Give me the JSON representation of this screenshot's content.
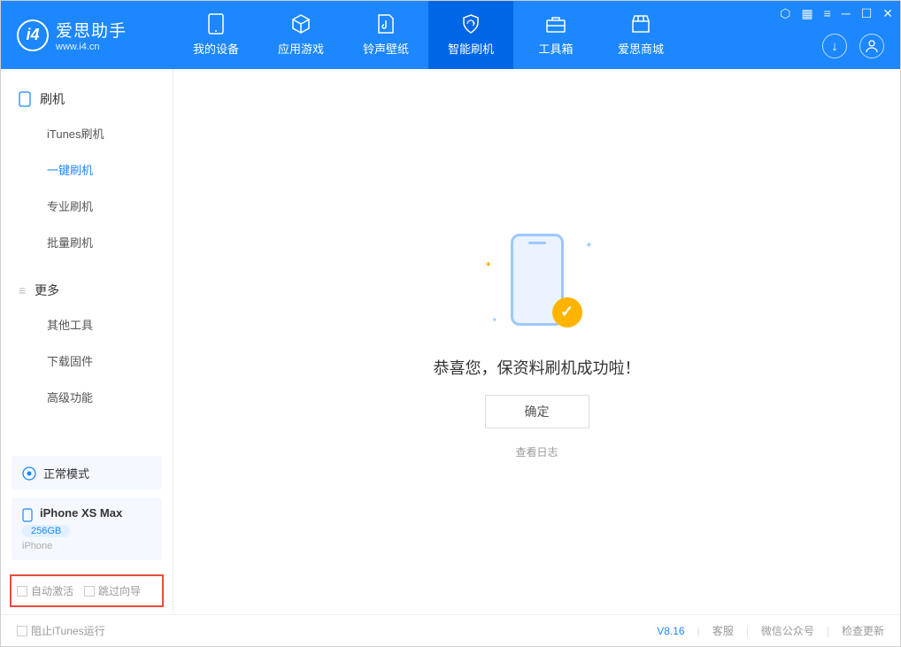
{
  "app": {
    "title": "爱思助手",
    "subtitle": "www.i4.cn"
  },
  "nav": {
    "tabs": [
      {
        "label": "我的设备"
      },
      {
        "label": "应用游戏"
      },
      {
        "label": "铃声壁纸"
      },
      {
        "label": "智能刷机"
      },
      {
        "label": "工具箱"
      },
      {
        "label": "爱思商城"
      }
    ]
  },
  "sidebar": {
    "group1": {
      "title": "刷机",
      "items": [
        {
          "label": "iTunes刷机"
        },
        {
          "label": "一键刷机"
        },
        {
          "label": "专业刷机"
        },
        {
          "label": "批量刷机"
        }
      ]
    },
    "group2": {
      "title": "更多",
      "items": [
        {
          "label": "其他工具"
        },
        {
          "label": "下载固件"
        },
        {
          "label": "高级功能"
        }
      ]
    },
    "mode": {
      "label": "正常模式"
    },
    "device": {
      "name": "iPhone XS Max",
      "storage": "256GB",
      "type": "iPhone"
    },
    "options": {
      "auto_activate": "自动激活",
      "skip_guide": "跳过向导"
    }
  },
  "main": {
    "success_text": "恭喜您，保资料刷机成功啦！",
    "ok_button": "确定",
    "view_log": "查看日志"
  },
  "footer": {
    "block_itunes": "阻止iTunes运行",
    "version": "V8.16",
    "links": {
      "support": "客服",
      "wechat": "微信公众号",
      "update": "检查更新"
    }
  }
}
